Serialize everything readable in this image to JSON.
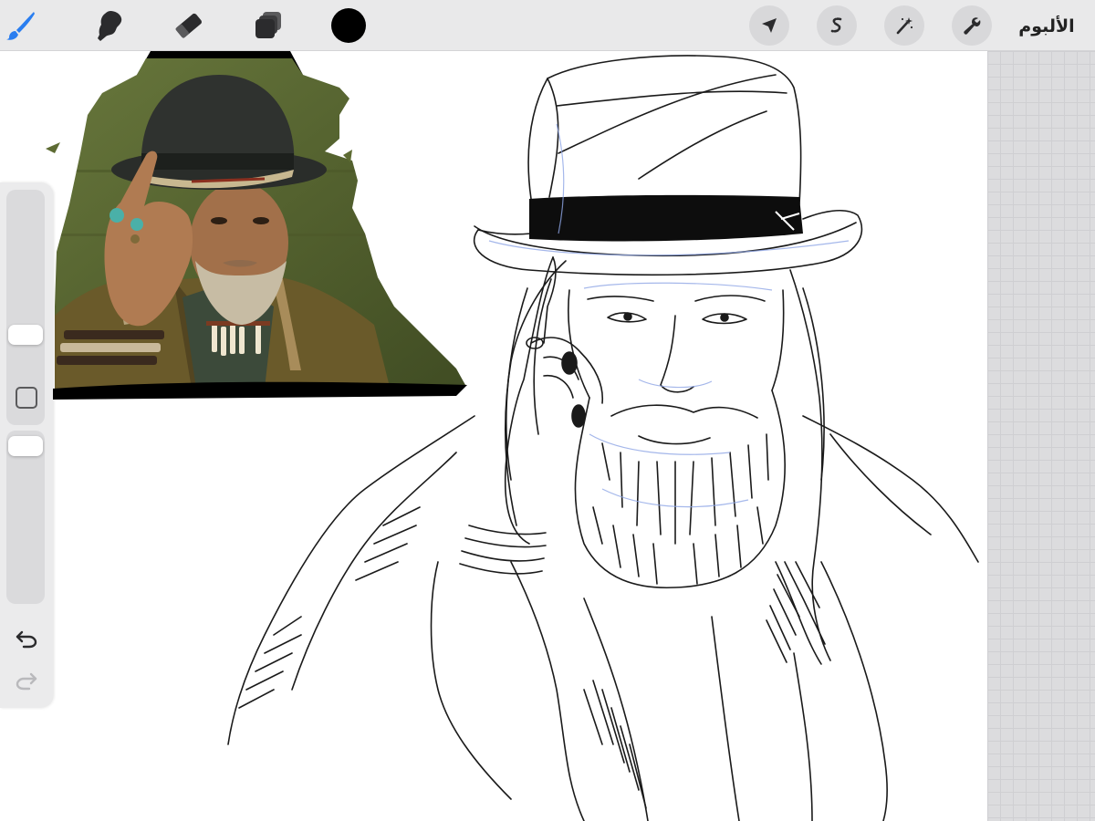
{
  "toolbar": {
    "tools": [
      {
        "name": "brush",
        "icon": "brush-icon",
        "active": true
      },
      {
        "name": "smudge",
        "icon": "smudge-icon",
        "active": false
      },
      {
        "name": "eraser",
        "icon": "eraser-icon",
        "active": false
      },
      {
        "name": "layers",
        "icon": "layers-icon",
        "active": false
      },
      {
        "name": "color",
        "icon": "color-swatch",
        "active": false
      }
    ],
    "current_color": "#000000",
    "active_tool_color": "#2a7ef0",
    "actions": [
      {
        "name": "transform",
        "icon": "arrow-cursor-icon"
      },
      {
        "name": "selection",
        "icon": "selection-s-icon"
      },
      {
        "name": "adjustments",
        "icon": "magic-wand-icon"
      },
      {
        "name": "actions",
        "icon": "wrench-icon"
      }
    ],
    "gallery_label": "الألبوم"
  },
  "sidebar": {
    "brush_size_level": 0.42,
    "opacity_level": 0.92,
    "controls": [
      "size-slider",
      "modify-button",
      "opacity-slider",
      "undo-button",
      "redo-button"
    ]
  },
  "canvas": {
    "background": "#ffffff",
    "grid_color": "#dcdcde",
    "layers": [
      {
        "name": "reference-photo",
        "icon": "photo-reference"
      },
      {
        "name": "pencil-sketch",
        "icon": "sketch-drawing"
      }
    ]
  }
}
